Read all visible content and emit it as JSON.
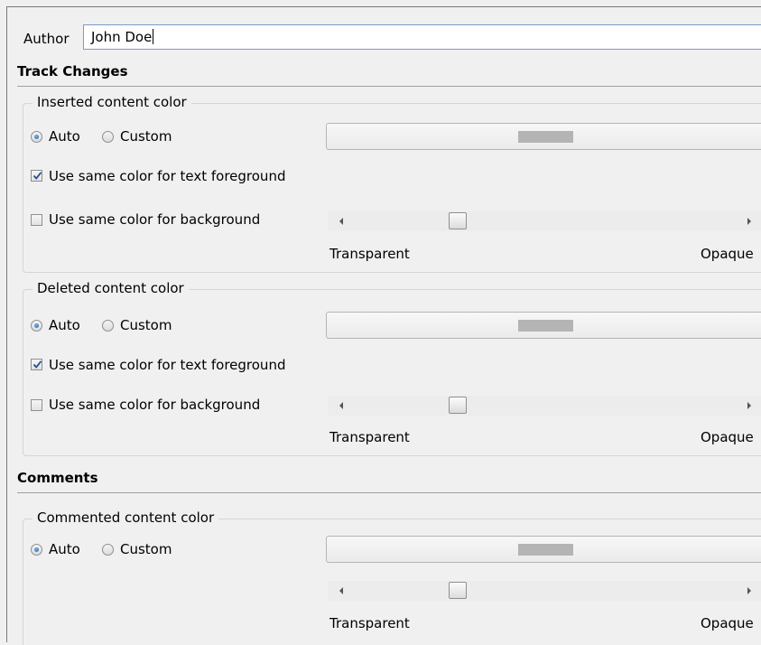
{
  "author": {
    "label": "Author",
    "value": "John Doe"
  },
  "track_changes": {
    "title": "Track Changes",
    "groups": [
      {
        "legend": "Inserted content color",
        "auto_label": "Auto",
        "custom_label": "Custom",
        "selected": "Auto",
        "swatch_color": "#b4b4b4",
        "foreground_label": "Use same color for text foreground",
        "foreground_checked": true,
        "background_label": "Use same color for background",
        "background_checked": false,
        "opacity": 0.27,
        "transparent_label": "Transparent",
        "opaque_label": "Opaque"
      },
      {
        "legend": "Deleted content color",
        "auto_label": "Auto",
        "custom_label": "Custom",
        "selected": "Auto",
        "swatch_color": "#b4b4b4",
        "foreground_label": "Use same color for text foreground",
        "foreground_checked": true,
        "background_label": "Use same color for background",
        "background_checked": false,
        "opacity": 0.27,
        "transparent_label": "Transparent",
        "opaque_label": "Opaque"
      }
    ]
  },
  "comments": {
    "title": "Comments",
    "group": {
      "legend": "Commented content color",
      "auto_label": "Auto",
      "custom_label": "Custom",
      "selected": "Auto",
      "swatch_color": "#b4b4b4",
      "opacity": 0.27,
      "transparent_label": "Transparent",
      "opaque_label": "Opaque"
    }
  }
}
